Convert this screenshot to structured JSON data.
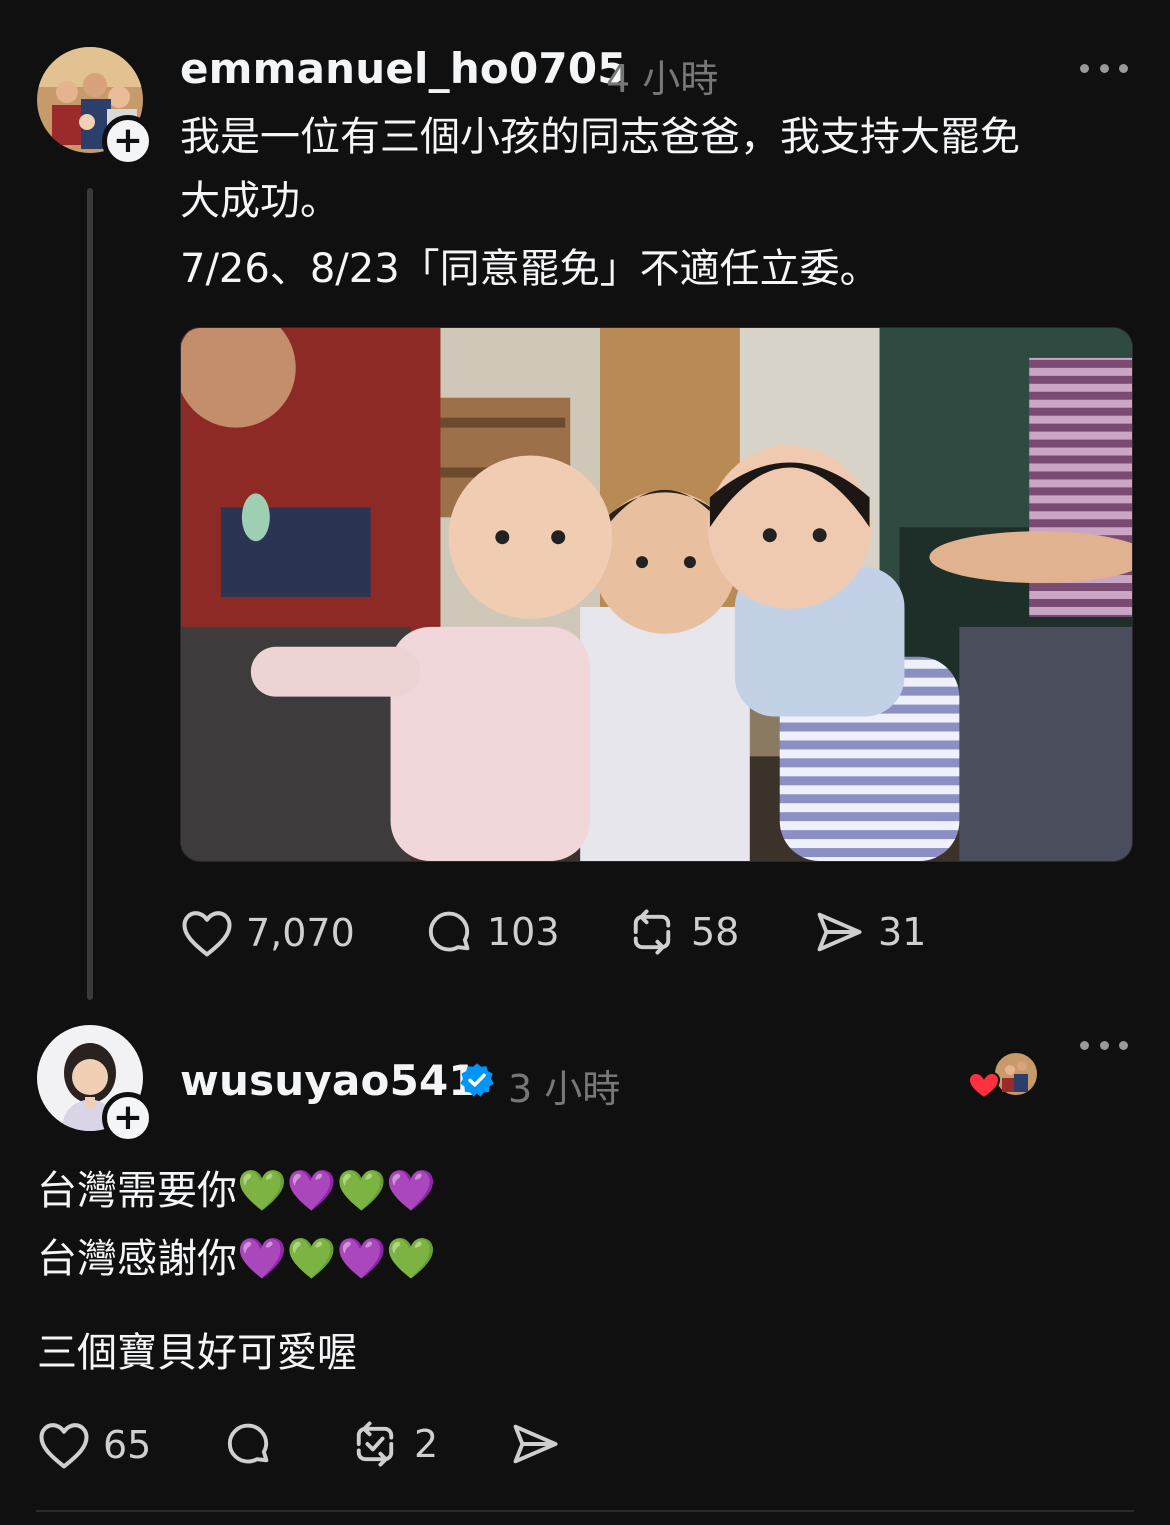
{
  "post": {
    "username": "emmanuel_ho0705",
    "time": "4 小時",
    "text_line1": "我是一位有三個小孩的同志爸爸，我支持大罷免",
    "text_line2": "大成功。",
    "text_line3": "7/26、8/23「同意罷免」不適任立委。",
    "stats": {
      "likes": "7,070",
      "replies": "103",
      "reposts": "58",
      "shares": "31"
    }
  },
  "reply": {
    "username": "wusuyao541",
    "time": "3 小時",
    "text_line1": "台灣需要你💚💜💚💜",
    "text_line2": "台灣感謝你💜💚💜💚",
    "text_line3": "三個寶貝好可愛喔",
    "stats": {
      "likes": "65",
      "replies": "",
      "reposts": "2"
    }
  },
  "icons": {
    "follow": "+",
    "like": "heart-icon",
    "reply": "comment-icon",
    "repost": "repost-icon",
    "share": "share-icon",
    "more": "more-icon",
    "verified": "verified-badge-icon"
  },
  "colors": {
    "background": "#101010",
    "text": "#f3f5f7",
    "muted": "#777777",
    "verified": "#0095f6",
    "liked_heart": "#ff3040"
  }
}
